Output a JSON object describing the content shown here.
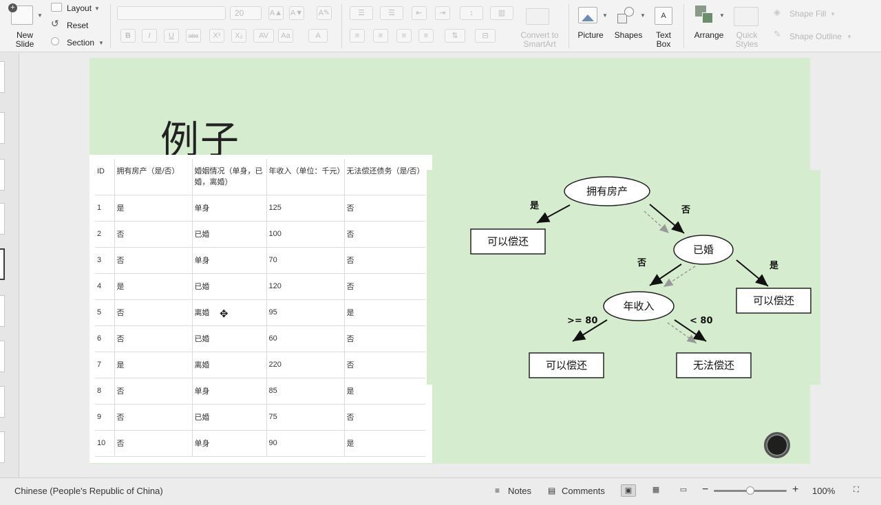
{
  "ribbon": {
    "new_slide": "New\nSlide",
    "layout": "Layout",
    "reset": "Reset",
    "section": "Section",
    "font_size": "20",
    "bold": "B",
    "italic": "I",
    "underline": "U",
    "strike": "abc",
    "superscript": "X²",
    "subscript": "X₂",
    "convert_smartart": "Convert to\nSmartArt",
    "picture": "Picture",
    "shapes": "Shapes",
    "text_box": "Text\nBox",
    "arrange": "Arrange",
    "quick_styles": "Quick\nStyles",
    "shape_fill": "Shape Fill",
    "shape_outline": "Shape Outline"
  },
  "slide": {
    "title": "例子",
    "table": {
      "headers": [
        "ID",
        "拥有房产（是/否）",
        "婚姻情况（单身，已婚，离婚）",
        "年收入（单位：千元）",
        "无法偿还债务（是/否）"
      ],
      "rows": [
        [
          "1",
          "是",
          "单身",
          "125",
          "否"
        ],
        [
          "2",
          "否",
          "已婚",
          "100",
          "否"
        ],
        [
          "3",
          "否",
          "单身",
          "70",
          "否"
        ],
        [
          "4",
          "是",
          "已婚",
          "120",
          "否"
        ],
        [
          "5",
          "否",
          "离婚",
          "95",
          "是"
        ],
        [
          "6",
          "否",
          "已婚",
          "60",
          "否"
        ],
        [
          "7",
          "是",
          "离婚",
          "220",
          "否"
        ],
        [
          "8",
          "否",
          "单身",
          "85",
          "是"
        ],
        [
          "9",
          "否",
          "已婚",
          "75",
          "否"
        ],
        [
          "10",
          "否",
          "单身",
          "90",
          "是"
        ]
      ]
    },
    "tree": {
      "root": "拥有房产",
      "root_yes_edge": "是",
      "root_yes_leaf": "可以偿还",
      "root_no_edge": "否",
      "married": "已婚",
      "married_yes_edge": "是",
      "married_yes_leaf": "可以偿还",
      "married_no_edge": "否",
      "income": "年收入",
      "income_ge_edge": ">= 80",
      "income_ge_leaf": "可以偿还",
      "income_lt_edge": "< 80",
      "income_lt_leaf": "无法偿还"
    }
  },
  "status": {
    "language": "Chinese (People's Republic of China)",
    "notes": "Notes",
    "comments": "Comments",
    "zoom": "100%",
    "zoom_level": 0.5
  }
}
